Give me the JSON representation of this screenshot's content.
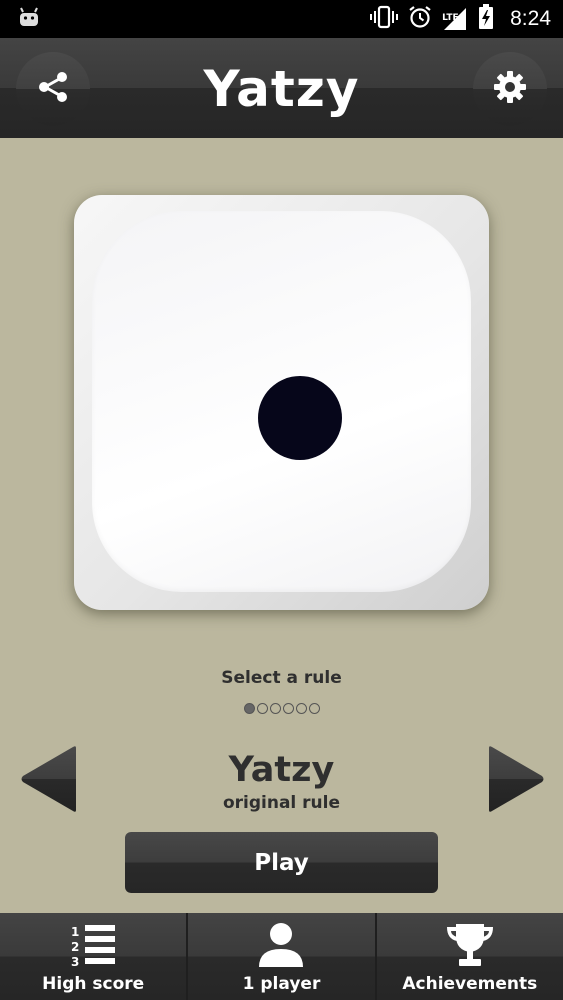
{
  "status_bar": {
    "time": "8:24",
    "network": "LTE",
    "icons": [
      "android-icon",
      "vibrate-icon",
      "alarm-icon",
      "signal-icon",
      "battery-charging-icon"
    ]
  },
  "header": {
    "title": "Yatzy",
    "left_icon": "share-icon",
    "right_icon": "gear-icon"
  },
  "die": {
    "face_value": 1
  },
  "rule_selector": {
    "label": "Select a rule",
    "page_count": 6,
    "active_index": 0,
    "rule_name": "Yatzy",
    "rule_description": "original rule"
  },
  "play_button": {
    "label": "Play"
  },
  "bottom_nav": {
    "items": [
      {
        "label": "High score",
        "icon": "ranked-list-icon"
      },
      {
        "label": "1 player",
        "icon": "person-icon"
      },
      {
        "label": "Achievements",
        "icon": "trophy-icon"
      }
    ]
  },
  "colors": {
    "background": "#bbb79e",
    "bar": "#2e2e2e",
    "text_dark": "#2f2f2f",
    "pip": "#06061a"
  }
}
